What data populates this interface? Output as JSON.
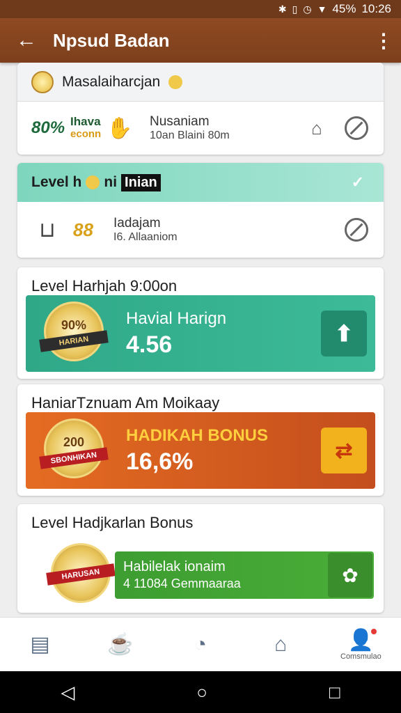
{
  "status_bar": {
    "icons": [
      "bluetooth-icon",
      "vibrate-icon",
      "alarm-icon",
      "wifi-icon"
    ],
    "battery": "45%",
    "time": "10:26"
  },
  "app_bar": {
    "title": "Npsud Badan"
  },
  "card1": {
    "header": "Masalaiharcjan",
    "brand_big": "80%",
    "brand_line1": "Ihava",
    "brand_line2": "econn",
    "item_title": "Nusaniam",
    "item_sub": "10an Blaini 80m"
  },
  "card2": {
    "header_prefix": "Level h",
    "header_mid": "ni",
    "header_tag": "Inian",
    "eight_text": "88",
    "item_title": "Iadajam",
    "item_sub": "I6. Allaaniom"
  },
  "card3": {
    "title": "Level Harhjah 9:00on",
    "medal_text": "90%",
    "medal_ribbon": "HARIAN",
    "banner_label": "Havial Harign",
    "banner_value": "4.56"
  },
  "card4": {
    "title": "HaniarTznuam Am Moikaay",
    "medal_text": "200",
    "medal_ribbon": "SBONHIKAN",
    "banner_label": "HADIKAH BONUS",
    "banner_value": "16,6%"
  },
  "card5": {
    "title": "Level Hadjkarlan Bonus",
    "medal_text": "HARUSAN",
    "banner_line1": "Habilelak ionaim",
    "banner_line2": "4 11084 Gemmaaraa"
  },
  "bottom_nav": {
    "profile_label": "Comsmulao"
  },
  "colors": {
    "app_bar": "#8e4a22",
    "teal_banner": "#2fa888",
    "orange_banner": "#e46c22",
    "green_banner": "#3d9d31"
  }
}
